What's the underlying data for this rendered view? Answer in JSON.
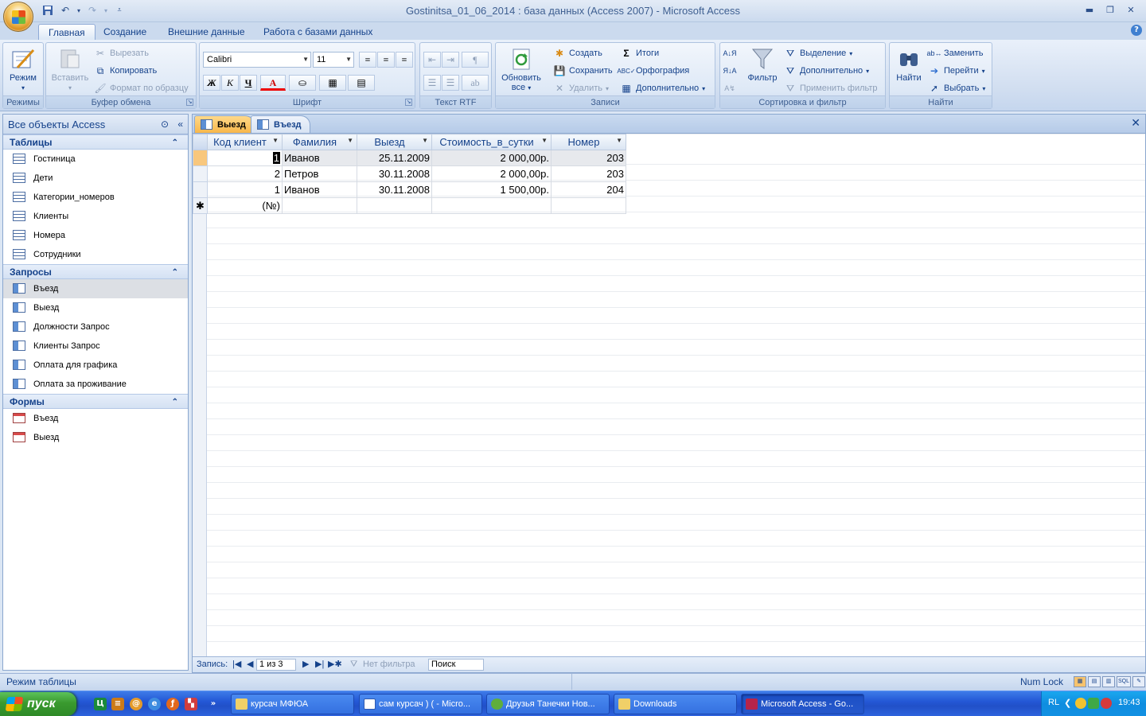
{
  "window": {
    "title": "Gostinitsa_01_06_2014 : база данных (Access 2007) - Microsoft Access"
  },
  "quick_access": [
    "save-icon",
    "undo-icon",
    "redo-icon",
    "customize-icon"
  ],
  "ribbon_tabs": [
    "Главная",
    "Создание",
    "Внешние данные",
    "Работа с базами данных"
  ],
  "ribbon": {
    "views": {
      "label": "Режимы",
      "mode_button": "Режим"
    },
    "clipboard": {
      "label": "Буфер обмена",
      "paste": "Вставить",
      "cut": "Вырезать",
      "copy": "Копировать",
      "format_painter": "Формат по образцу"
    },
    "font": {
      "label": "Шрифт",
      "font_name": "Calibri",
      "font_size": "11",
      "bold": "Ж",
      "italic": "К",
      "underline": "Ч",
      "font_color": "A"
    },
    "rtf": {
      "label": "Текст RTF"
    },
    "records": {
      "label": "Записи",
      "refresh": "Обновить",
      "refresh2": "все",
      "new": "Создать",
      "save": "Сохранить",
      "delete": "Удалить",
      "totals": "Итоги",
      "spelling": "Орфография",
      "more": "Дополнительно"
    },
    "sort_filter": {
      "label": "Сортировка и фильтр",
      "filter": "Фильтр",
      "selection": "Выделение",
      "advanced": "Дополнительно",
      "toggle_filter": "Применить фильтр"
    },
    "find": {
      "label": "Найти",
      "find": "Найти",
      "replace": "Заменить",
      "goto": "Перейти",
      "select": "Выбрать"
    }
  },
  "nav": {
    "header": "Все объекты Access",
    "sections": [
      {
        "title": "Таблицы",
        "items": [
          "Гостиница",
          "Дети",
          "Категории_номеров",
          "Клиенты",
          "Номера",
          "Сотрудники"
        ]
      },
      {
        "title": "Запросы",
        "items": [
          "Въезд",
          "Выезд",
          "Должности Запрос",
          "Клиенты Запрос",
          "Оплата для графика",
          "Оплата за проживание"
        ]
      },
      {
        "title": "Формы",
        "items": [
          "Въезд",
          "Выезд"
        ]
      }
    ]
  },
  "doc_tabs": [
    "Выезд",
    "Въезд"
  ],
  "datasheet": {
    "columns": [
      "Код клиент",
      "Фамилия",
      "Выезд",
      "Стоимость_в_сутки",
      "Номер"
    ],
    "rows": [
      [
        "1",
        "Иванов",
        "25.11.2009",
        "2 000,00р.",
        "203"
      ],
      [
        "2",
        "Петров",
        "30.11.2008",
        "2 000,00р.",
        "203"
      ],
      [
        "1",
        "Иванов",
        "30.11.2008",
        "1 500,00р.",
        "204"
      ]
    ],
    "new_row_marker": "(№)"
  },
  "record_nav": {
    "label": "Запись:",
    "position": "1 из 3",
    "no_filter": "Нет фильтра",
    "search": "Поиск"
  },
  "statusbar": {
    "mode": "Режим таблицы",
    "num_lock": "Num Lock"
  },
  "taskbar": {
    "start": "пуск",
    "tasks": [
      "курсач МФЮА",
      "сам курсач ) ( - Micro...",
      "Друзья Танечки Нов...",
      "Downloads",
      "Microsoft Access - Go..."
    ],
    "lang": "RL",
    "clock": "19:43"
  }
}
